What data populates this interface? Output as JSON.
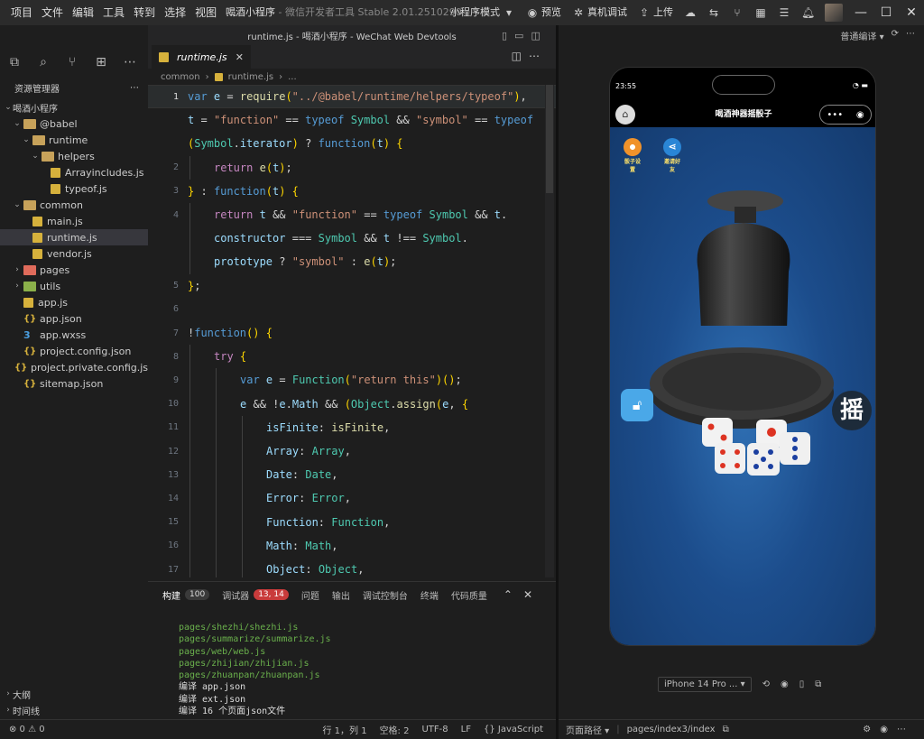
{
  "menu": [
    "项目",
    "文件",
    "编辑",
    "工具",
    "转到",
    "选择",
    "视图",
    "…"
  ],
  "app_title": "喝酒小程序",
  "app_subtitle": " - 微信开发者工具 Stable 2.01.2510290",
  "topbar": {
    "mode": "小程序模式",
    "preview": "预览",
    "real_debug": "真机调试",
    "upload": "上传"
  },
  "editor_title": "runtime.js - 喝酒小程序 - WeChat Web Devtools",
  "explorer": {
    "header": "资源管理器",
    "project": "喝酒小程序",
    "items": [
      {
        "label": "@babel",
        "depth": 1,
        "type": "folder",
        "open": true
      },
      {
        "label": "runtime",
        "depth": 2,
        "type": "folder",
        "open": true
      },
      {
        "label": "helpers",
        "depth": 3,
        "type": "folder",
        "open": true
      },
      {
        "label": "Arrayincludes.js",
        "depth": 4,
        "type": "js"
      },
      {
        "label": "typeof.js",
        "depth": 4,
        "type": "js"
      },
      {
        "label": "common",
        "depth": 1,
        "type": "folder",
        "open": true
      },
      {
        "label": "main.js",
        "depth": 2,
        "type": "js"
      },
      {
        "label": "runtime.js",
        "depth": 2,
        "type": "js",
        "selected": true
      },
      {
        "label": "vendor.js",
        "depth": 2,
        "type": "js"
      },
      {
        "label": "pages",
        "depth": 1,
        "type": "folder",
        "color": "r"
      },
      {
        "label": "utils",
        "depth": 1,
        "type": "folder",
        "color": "g"
      },
      {
        "label": "app.js",
        "depth": 1,
        "type": "js"
      },
      {
        "label": "app.json",
        "depth": 1,
        "type": "json"
      },
      {
        "label": "app.wxss",
        "depth": 1,
        "type": "wxss"
      },
      {
        "label": "project.config.json",
        "depth": 1,
        "type": "json"
      },
      {
        "label": "project.private.config.js...",
        "depth": 1,
        "type": "json"
      },
      {
        "label": "sitemap.json",
        "depth": 1,
        "type": "json"
      }
    ],
    "outline": "大纲",
    "timeline": "时间线",
    "problems": "⊗ 0 ⚠ 0"
  },
  "tab": {
    "label": "runtime.js"
  },
  "breadcrumb": [
    "common",
    "runtime.js",
    "..."
  ],
  "code_lines": [
    {
      "n": "1",
      "indent": 0,
      "html": "<span class='k2'>var</span> <span class='id'>e</span> <span class='tx'>=</span> <span class='fn'>require</span><span class='br'>(</span><span class='st'>\"../@babel/runtime/helpers/typeof\"</span><span class='br'>)</span><span class='tx'>,</span>"
    },
    {
      "n": "",
      "indent": 0,
      "html": "<span class='id'>t</span> <span class='tx'>=</span> <span class='st'>\"function\"</span> <span class='tx'>==</span> <span class='k2'>typeof</span> <span class='ty'>Symbol</span> <span class='tx'>&amp;&amp;</span> <span class='st'>\"symbol\"</span> <span class='tx'>==</span> <span class='k2'>typeof</span>"
    },
    {
      "n": "",
      "indent": 0,
      "html": "<span class='br'>(</span><span class='ty'>Symbol</span><span class='tx'>.</span><span class='id'>iterator</span><span class='br'>)</span> <span class='tx'>?</span> <span class='k2'>function</span><span class='br'>(</span><span class='id'>t</span><span class='br'>)</span> <span class='br'>{</span>"
    },
    {
      "n": "2",
      "indent": 1,
      "html": "<span class='kw'>return</span> <span class='fn'>e</span><span class='br'>(</span><span class='id'>t</span><span class='br'>)</span><span class='tx'>;</span>"
    },
    {
      "n": "3",
      "indent": 0,
      "html": "<span class='br'>}</span> <span class='tx'>:</span> <span class='k2'>function</span><span class='br'>(</span><span class='id'>t</span><span class='br'>)</span> <span class='br'>{</span>"
    },
    {
      "n": "4",
      "indent": 1,
      "html": "<span class='kw'>return</span> <span class='id'>t</span> <span class='tx'>&amp;&amp;</span> <span class='st'>\"function\"</span> <span class='tx'>==</span> <span class='k2'>typeof</span> <span class='ty'>Symbol</span> <span class='tx'>&amp;&amp;</span> <span class='id'>t</span><span class='tx'>.</span>"
    },
    {
      "n": "",
      "indent": 1,
      "html": "<span class='id'>constructor</span> <span class='tx'>===</span> <span class='ty'>Symbol</span> <span class='tx'>&amp;&amp;</span> <span class='id'>t</span> <span class='tx'>!==</span> <span class='ty'>Symbol</span><span class='tx'>.</span>"
    },
    {
      "n": "",
      "indent": 1,
      "html": "<span class='id'>prototype</span> <span class='tx'>?</span> <span class='st'>\"symbol\"</span> <span class='tx'>:</span> <span class='fn'>e</span><span class='br'>(</span><span class='id'>t</span><span class='br'>)</span><span class='tx'>;</span>"
    },
    {
      "n": "5",
      "indent": 0,
      "html": "<span class='br'>}</span><span class='tx'>;</span>"
    },
    {
      "n": "6",
      "indent": 0,
      "html": ""
    },
    {
      "n": "7",
      "indent": 0,
      "html": "<span class='tx'>!</span><span class='k2'>function</span><span class='br'>()</span> <span class='br'>{</span>"
    },
    {
      "n": "8",
      "indent": 1,
      "html": "<span class='kw'>try</span> <span class='br'>{</span>"
    },
    {
      "n": "9",
      "indent": 2,
      "html": "<span class='k2'>var</span> <span class='id'>e</span> <span class='tx'>=</span> <span class='ty'>Function</span><span class='br'>(</span><span class='st'>\"return this\"</span><span class='br'>)()</span><span class='tx'>;</span>"
    },
    {
      "n": "10",
      "indent": 2,
      "html": "<span class='id'>e</span> <span class='tx'>&amp;&amp;</span> <span class='tx'>!</span><span class='id'>e</span><span class='tx'>.</span><span class='id'>Math</span> <span class='tx'>&amp;&amp;</span> <span class='br'>(</span><span class='ty'>Object</span><span class='tx'>.</span><span class='fn'>assign</span><span class='br'>(</span><span class='id'>e</span><span class='tx'>,</span> <span class='br'>{</span>"
    },
    {
      "n": "11",
      "indent": 3,
      "html": "<span class='id'>isFinite</span><span class='tx'>:</span> <span class='fn'>isFinite</span><span class='tx'>,</span>"
    },
    {
      "n": "12",
      "indent": 3,
      "html": "<span class='id'>Array</span><span class='tx'>:</span> <span class='ty'>Array</span><span class='tx'>,</span>"
    },
    {
      "n": "13",
      "indent": 3,
      "html": "<span class='id'>Date</span><span class='tx'>:</span> <span class='ty'>Date</span><span class='tx'>,</span>"
    },
    {
      "n": "14",
      "indent": 3,
      "html": "<span class='id'>Error</span><span class='tx'>:</span> <span class='ty'>Error</span><span class='tx'>,</span>"
    },
    {
      "n": "15",
      "indent": 3,
      "html": "<span class='id'>Function</span><span class='tx'>:</span> <span class='ty'>Function</span><span class='tx'>,</span>"
    },
    {
      "n": "16",
      "indent": 3,
      "html": "<span class='id'>Math</span><span class='tx'>:</span> <span class='ty'>Math</span><span class='tx'>,</span>"
    },
    {
      "n": "17",
      "indent": 3,
      "html": "<span class='id'>Object</span><span class='tx'>:</span> <span class='ty'>Object</span><span class='tx'>,</span>"
    }
  ],
  "panel": {
    "tabs": [
      {
        "label": "构建",
        "badge": "100",
        "active": true
      },
      {
        "label": "调试器",
        "badge": "13, 14",
        "red": true
      },
      {
        "label": "问题"
      },
      {
        "label": "输出"
      },
      {
        "label": "调试控制台"
      },
      {
        "label": "终端"
      },
      {
        "label": "代码质量"
      }
    ],
    "log": [
      {
        "t": "pages/shezhi/shezhi.js",
        "c": "g"
      },
      {
        "t": "pages/summarize/summarize.js",
        "c": "g"
      },
      {
        "t": "pages/web/web.js",
        "c": "g"
      },
      {
        "t": "pages/zhijian/zhijian.js",
        "c": "g"
      },
      {
        "t": "pages/zhuanpan/zhuanpan.js",
        "c": "g"
      },
      {
        "t": "编译 app.json",
        "c": "w"
      },
      {
        "t": "编译 ext.json",
        "c": "w"
      },
      {
        "t": "编译 16 个页面json文件",
        "c": "w"
      }
    ]
  },
  "status": {
    "pos": "行 1，列 1",
    "spaces": "空格: 2",
    "encoding": "UTF-8",
    "eol": "LF",
    "lang": "{} JavaScript"
  },
  "simulator": {
    "compile_mode": "普通编译",
    "time": "23:55",
    "page_title": "喝酒神器摇骰子",
    "tool1": "骰子设置",
    "tool2": "邀请好友",
    "shake": "摇",
    "device": "iPhone 14 Pro ...",
    "path_label": "页面路径",
    "path": "pages/index3/index"
  },
  "colors": {
    "accent": "#2f6fb3",
    "folder": "#c7a25a",
    "js": "#d6b13c"
  }
}
